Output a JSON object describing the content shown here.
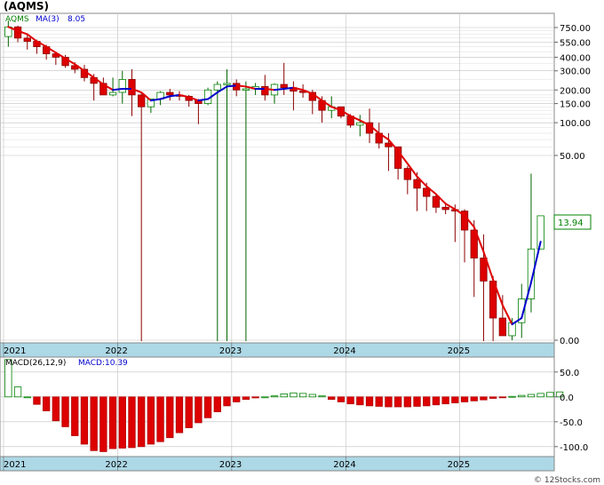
{
  "title": "(AQMS)",
  "price_panel": {
    "ticker": "AQMS",
    "ma_label": "MA(3)",
    "ma_value": "8.05",
    "last_price": "13.94",
    "y_ticks": [
      "750.00",
      "550.00",
      "400.00",
      "300.00",
      "200.00",
      "150.00",
      "100.00",
      "50.00",
      "0.00"
    ],
    "scale": "log"
  },
  "macd_panel": {
    "label": "MACD(26,12,9)",
    "value_label": "MACD:10.39",
    "y_ticks": [
      "50.0",
      "0.0",
      "-50.0",
      "-100.0"
    ]
  },
  "x_axis": {
    "labels": [
      "2021",
      "2022",
      "2023",
      "2024",
      "2025"
    ]
  },
  "footer": "© 12Stocks.com",
  "colors": {
    "up": "#33cc33",
    "down": "#dd0000",
    "ma_down": "#e00000",
    "ma_up": "#0000cc",
    "axis_band": "#add8e6",
    "grid": "#c0c0c0",
    "text_green": "#008000",
    "text_blue": "#0000cc"
  },
  "chart_data": [
    {
      "type": "candlestick",
      "title": "(AQMS)",
      "scale": "log",
      "price_unit_note": "monthly bars, prices in USD",
      "categories": [
        "2021-01",
        "2021-02",
        "2021-03",
        "2021-04",
        "2021-05",
        "2021-06",
        "2021-07",
        "2021-08",
        "2021-09",
        "2021-10",
        "2021-11",
        "2021-12",
        "2022-01",
        "2022-02",
        "2022-03",
        "2022-04",
        "2022-05",
        "2022-06",
        "2022-07",
        "2022-08",
        "2022-09",
        "2022-10",
        "2022-11",
        "2022-12",
        "2023-01",
        "2023-02",
        "2023-03",
        "2023-04",
        "2023-05",
        "2023-06",
        "2023-07",
        "2023-08",
        "2023-09",
        "2023-10",
        "2023-11",
        "2023-12",
        "2024-01",
        "2024-02",
        "2024-03",
        "2024-04",
        "2024-05",
        "2024-06",
        "2024-07",
        "2024-08",
        "2024-09",
        "2024-10",
        "2024-11",
        "2024-12",
        "2025-01",
        "2025-02",
        "2025-03",
        "2025-04",
        "2025-05",
        "2025-06",
        "2025-07",
        "2025-08",
        "2025-09",
        "2025-10",
        "2025-11"
      ],
      "open": [
        620,
        760,
        600,
        560,
        500,
        430,
        400,
        335,
        310,
        260,
        230,
        180,
        190,
        250,
        180,
        140,
        165,
        190,
        180,
        175,
        160,
        150,
        200,
        225,
        230,
        200,
        205,
        215,
        180,
        225,
        210,
        195,
        190,
        160,
        130,
        140,
        115,
        95,
        100,
        80,
        65,
        60,
        38,
        30,
        25,
        21,
        16.7,
        15.9,
        15.4,
        10.3,
        5.7,
        3.5,
        1.6,
        1.1,
        1.45,
        2.4,
        6.9
      ],
      "high": [
        870,
        780,
        640,
        580,
        520,
        450,
        420,
        360,
        340,
        280,
        260,
        260,
        300,
        310,
        190,
        145,
        195,
        205,
        195,
        180,
        165,
        210,
        240,
        310,
        250,
        240,
        232,
        275,
        230,
        355,
        240,
        225,
        200,
        175,
        175,
        140,
        120,
        118,
        135,
        100,
        80,
        60,
        40,
        35,
        28,
        22,
        18.5,
        17.7,
        16,
        12.7,
        9.4,
        3.9,
        2.6,
        1.6,
        3.3,
        34
      ],
      "low": [
        500,
        550,
        470,
        430,
        380,
        340,
        320,
        285,
        240,
        160,
        200,
        175,
        150,
        115,
        0.001,
        123,
        145,
        160,
        160,
        140,
        97,
        145,
        0.6,
        0.6,
        175,
        0.6,
        180,
        160,
        150,
        180,
        130,
        170,
        120,
        100,
        110,
        110,
        90,
        75,
        65,
        58,
        36,
        30,
        22,
        15.4,
        15.4,
        14.8,
        14.4,
        8.0,
        5.2,
        2.5,
        0.98,
        0.93,
        1.1,
        1.0,
        1.05,
        1.8
      ],
      "close": [
        760,
        600,
        560,
        500,
        430,
        400,
        335,
        310,
        260,
        230,
        180,
        190,
        250,
        180,
        140,
        165,
        190,
        180,
        175,
        160,
        150,
        200,
        225,
        230,
        200,
        205,
        215,
        180,
        225,
        210,
        195,
        190,
        160,
        130,
        140,
        115,
        95,
        100,
        80,
        65,
        60,
        38,
        30,
        25,
        21,
        16.7,
        15.9,
        15.4,
        10.3,
        5.7,
        3.5,
        1.6,
        1.1,
        1.45,
        2.4,
        6.9,
        13.94
      ],
      "ma3": [
        760,
        700,
        650,
        560,
        500,
        440,
        390,
        345,
        300,
        260,
        225,
        200,
        205,
        205,
        190,
        160,
        165,
        175,
        180,
        172,
        160,
        165,
        190,
        215,
        220,
        215,
        205,
        205,
        200,
        205,
        210,
        200,
        185,
        160,
        140,
        130,
        115,
        105,
        95,
        80,
        70,
        55,
        42,
        32,
        26,
        22,
        18,
        16,
        14,
        11,
        6.5,
        3.6,
        2.1,
        1.4,
        1.6,
        3.4,
        8.05
      ]
    },
    {
      "type": "bar",
      "title": "MACD(26,12,9)",
      "value_label": "MACD:10.39",
      "values": [
        75,
        20,
        0,
        -15,
        -28,
        -48,
        -60,
        -78,
        -95,
        -108,
        -110,
        -104,
        -103,
        -102,
        -100,
        -95,
        -90,
        -82,
        -72,
        -62,
        -52,
        -42,
        -30,
        -18,
        -10,
        -5,
        -2,
        0,
        2,
        6,
        8,
        7,
        5,
        2,
        -5,
        -10,
        -14,
        -16,
        -18,
        -19,
        -20,
        -20,
        -20,
        -19,
        -18,
        -16,
        -14,
        -12,
        -10,
        -8,
        -6,
        -3,
        -1,
        1,
        3,
        5,
        7,
        9,
        10
      ],
      "ylim": [
        -120,
        80
      ],
      "y_ticks": [
        50,
        0,
        -50,
        -100
      ]
    }
  ]
}
